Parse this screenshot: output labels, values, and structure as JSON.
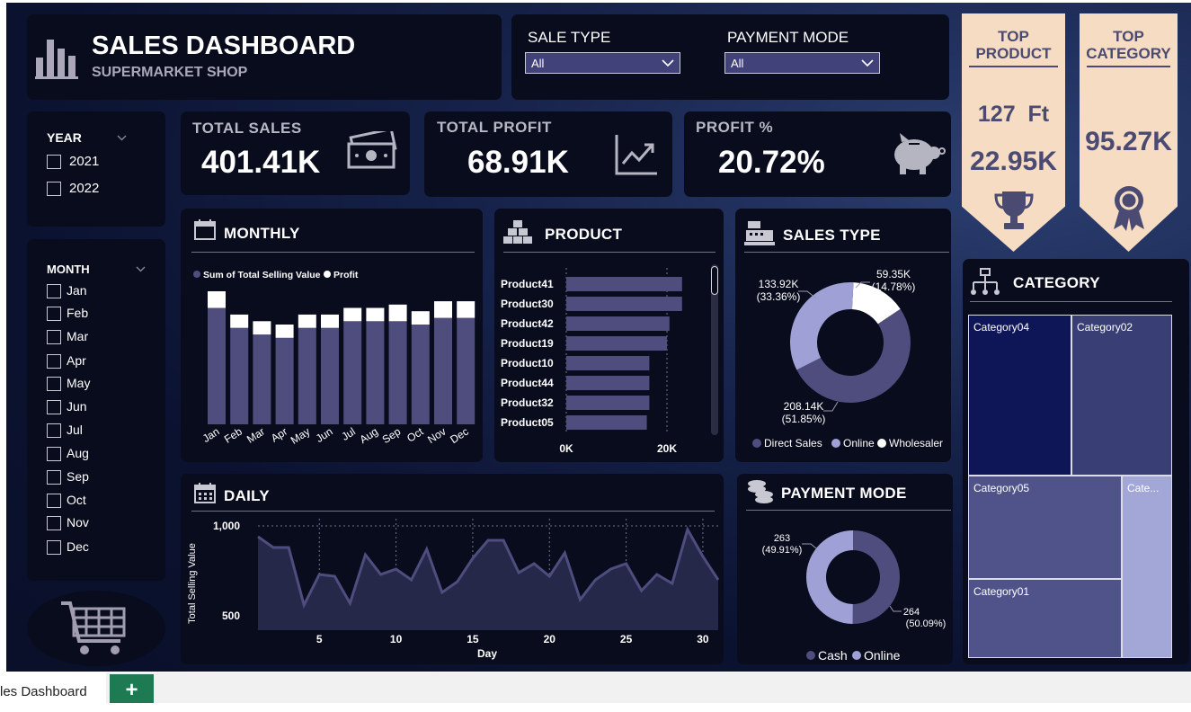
{
  "header": {
    "title": "SALES DASHBOARD",
    "subtitle": "SUPERMARKET SHOP"
  },
  "filters": {
    "sale_type": {
      "label": "SALE TYPE",
      "value": "All"
    },
    "payment_mode": {
      "label": "PAYMENT MODE",
      "value": "All"
    },
    "year": {
      "label": "YEAR",
      "options": [
        "2021",
        "2022"
      ]
    },
    "month": {
      "label": "MONTH",
      "options": [
        "Jan",
        "Feb",
        "Mar",
        "Apr",
        "May",
        "Jun",
        "Jul",
        "Aug",
        "Sep",
        "Oct",
        "Nov",
        "Dec"
      ]
    }
  },
  "kpis": {
    "total_sales": {
      "label": "TOTAL SALES",
      "value": "401.41K"
    },
    "total_profit": {
      "label": "TOTAL PROFIT",
      "value": "68.91K"
    },
    "profit_pct": {
      "label": "PROFIT %",
      "value": "20.72%"
    }
  },
  "top_product": {
    "title_line1": "TOP",
    "title_line2": "PRODUCT",
    "name": "127  Ft",
    "value": "22.95K"
  },
  "top_category": {
    "title_line1": "TOP",
    "title_line2": "CATEGORY",
    "value": "95.27K"
  },
  "sections": {
    "monthly": "MONTHLY",
    "product": "PRODUCT",
    "sales_type": "SALES TYPE",
    "daily": "DAILY",
    "payment_mode": "PAYMENT MODE",
    "category": "CATEGORY"
  },
  "colors": {
    "series_dark": "#4f4c7e",
    "series_light": "#9fa1d6",
    "accent_tag": "#f5dcc3",
    "panel": "#090c1d"
  },
  "chart_data": [
    {
      "id": "monthly",
      "type": "bar",
      "legend": [
        "Sum of Total Selling Value",
        "Profit"
      ],
      "categories": [
        "Jan",
        "Feb",
        "Mar",
        "Apr",
        "May",
        "Jun",
        "Jul",
        "Aug",
        "Sep",
        "Oct",
        "Nov",
        "Dec"
      ],
      "series": [
        {
          "name": "Sum of Total Selling Value",
          "values": [
            35,
            29,
            27,
            26,
            29,
            29,
            31,
            31,
            31,
            30,
            32,
            32
          ]
        },
        {
          "name": "Profit",
          "values": [
            5,
            4,
            4,
            4,
            4,
            4,
            4,
            4,
            5,
            4,
            5,
            5
          ]
        }
      ]
    },
    {
      "id": "product",
      "type": "bar",
      "orientation": "horizontal",
      "categories": [
        "Product41",
        "Product30",
        "Product42",
        "Product19",
        "Product10",
        "Product44",
        "Product32",
        "Product05"
      ],
      "values": [
        23000,
        23000,
        20500,
        20000,
        16500,
        16500,
        16500,
        16000
      ],
      "xticks": [
        "0K",
        "20K"
      ],
      "xlim": [
        0,
        25000
      ]
    },
    {
      "id": "sales_type",
      "type": "pie",
      "labels": [
        "Direct Sales",
        "Online",
        "Wholesaler"
      ],
      "values": [
        208.14,
        133.92,
        59.35
      ],
      "data_labels": [
        "208.14K",
        "(51.85%)",
        "133.92K",
        "(33.36%)",
        "59.35K",
        "(14.78%)"
      ]
    },
    {
      "id": "daily",
      "type": "area",
      "xlabel": "Day",
      "ylabel": "Total Selling Value",
      "x": [
        1,
        2,
        3,
        4,
        5,
        6,
        7,
        8,
        9,
        10,
        11,
        12,
        13,
        14,
        15,
        16,
        17,
        18,
        19,
        20,
        21,
        22,
        23,
        24,
        25,
        26,
        27,
        28,
        29,
        30,
        31
      ],
      "values": [
        940,
        880,
        880,
        560,
        730,
        720,
        570,
        840,
        730,
        760,
        700,
        870,
        630,
        690,
        820,
        920,
        920,
        740,
        790,
        720,
        850,
        590,
        700,
        760,
        790,
        640,
        730,
        680,
        980,
        830,
        700
      ],
      "yticks": [
        "1,000",
        "500"
      ],
      "xticks": [
        "5",
        "10",
        "15",
        "20",
        "25",
        "30"
      ],
      "ylim": [
        420,
        1040
      ]
    },
    {
      "id": "payment_mode",
      "type": "pie",
      "labels": [
        "Cash",
        "Online"
      ],
      "values": [
        264,
        263
      ],
      "data_labels": [
        "263",
        "(49.91%)",
        "264",
        "(50.09%)"
      ]
    },
    {
      "id": "category",
      "type": "heatmap",
      "labels": [
        "Category04",
        "Category02",
        "Category05",
        "Cate...",
        "Category01"
      ]
    }
  ],
  "bottom": {
    "sheet_name": "les Dashboard",
    "add_symbol": "+"
  }
}
